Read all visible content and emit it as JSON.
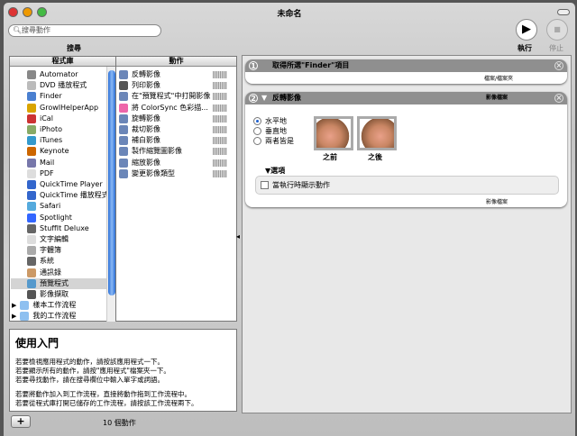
{
  "window": {
    "title": "未命名"
  },
  "toolbar": {
    "search_placeholder": "搜尋動作",
    "search_label": "搜尋",
    "run_label": "執行",
    "stop_label": "停止"
  },
  "library": {
    "header": "程式庫",
    "items": [
      "Automator",
      "DVD 播放程式",
      "Finder",
      "GrowlHelperApp",
      "iCal",
      "iPhoto",
      "iTunes",
      "Keynote",
      "Mail",
      "PDF",
      "QuickTime Player",
      "QuickTime 播放程式",
      "Safari",
      "Spotlight",
      "StuffIt Deluxe",
      "文字編輯",
      "字體簿",
      "系統",
      "通訊錄",
      "預覽程式",
      "影像擷取"
    ],
    "selected": "預覽程式",
    "folders": [
      "樣本工作流程",
      "我的工作流程"
    ]
  },
  "actions": {
    "header": "動作",
    "items": [
      "反轉影像",
      "列印影像",
      "在\"預覽程式\"中打開影像",
      "將 ColorSync 色彩描...",
      "旋轉影像",
      "裁切影像",
      "補白影像",
      "製作縮覽圖影像",
      "縮放影像",
      "變更影像類型"
    ]
  },
  "help": {
    "title": "使用入門",
    "lines": [
      "若要檢視應用程式的動作，請按該應用程式一下。",
      "若要顯示所有的動作，請按\"應用程式\"檔案夾一下。",
      "若要尋找動作，請在搜尋欄位中輸入單字或詞語。",
      "",
      "若要將動作加入到工作流程，直接將動作拖到工作流程中。",
      "若要從程式庫打開已儲存的工作流程，請按該工作流程兩下。"
    ]
  },
  "footer": {
    "count": "10 個動作",
    "add_label": "+"
  },
  "workflow": {
    "steps": [
      {
        "number": "1",
        "title": "取得所選\"Finder\"項目",
        "output": "檔案/檔案夾"
      },
      {
        "number": "2",
        "title": "反轉影像",
        "input": "影像檔案",
        "options": [
          "水平地",
          "垂直地",
          "兩者皆是"
        ],
        "selected_option": "水平地",
        "before_label": "之前",
        "after_label": "之後",
        "options_label": "選項",
        "show_when_run": "當執行時顯示動作",
        "output": "影像檔案"
      }
    ]
  }
}
